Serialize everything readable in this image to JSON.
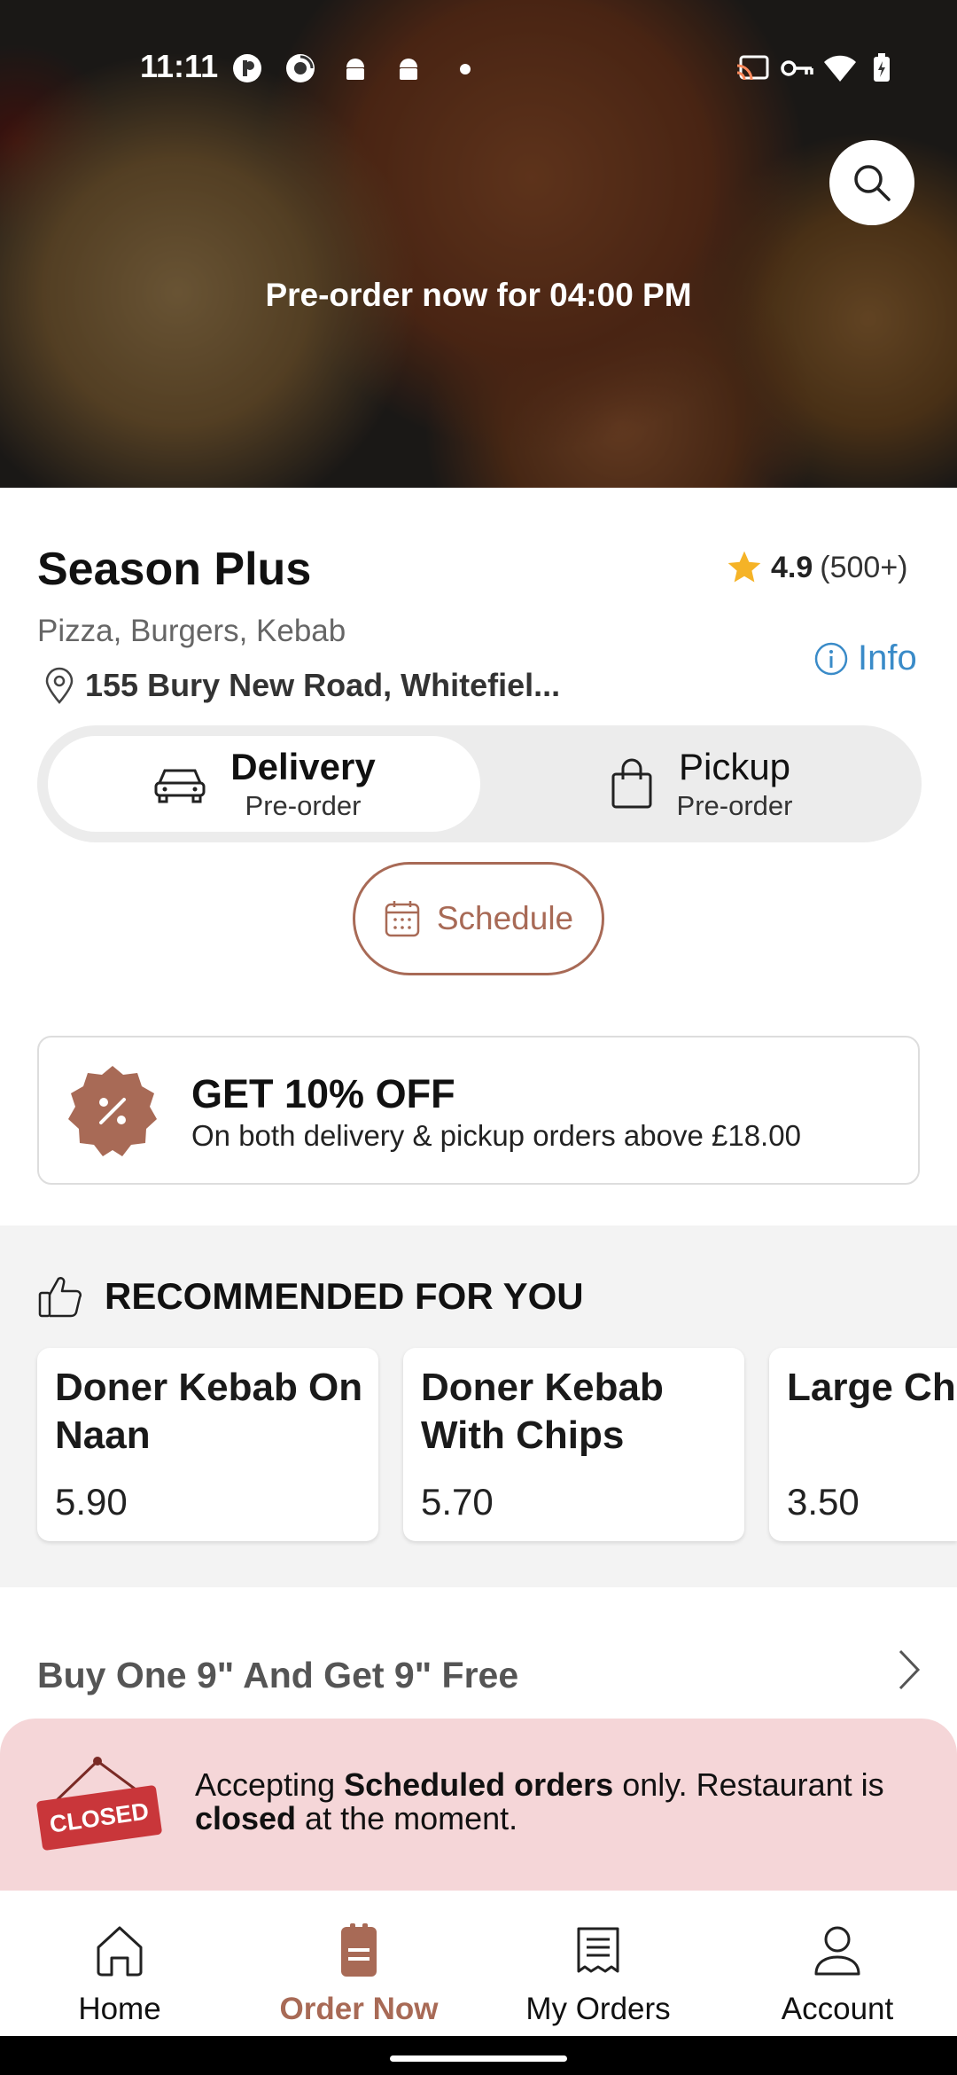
{
  "status_bar": {
    "time": "11:11",
    "icons": [
      "app-icon-1",
      "app-icon-2",
      "android-icon",
      "android-icon",
      "dot-indicator",
      "cast-icon",
      "vpn-key-icon",
      "wifi-icon",
      "battery-charging-icon"
    ]
  },
  "hero": {
    "banner_text": "Pre-order now for 04:00 PM",
    "search_icon": "search-icon"
  },
  "restaurant": {
    "name": "Season Plus",
    "rating": "4.9",
    "rating_count": "(500+)",
    "cuisines": "Pizza, Burgers, Kebab",
    "address": "155 Bury New Road, Whitefiel...",
    "info_label": "Info"
  },
  "order_type": {
    "options": [
      {
        "label": "Delivery",
        "sub": "Pre-order",
        "icon": "car-icon",
        "selected": true
      },
      {
        "label": "Pickup",
        "sub": "Pre-order",
        "icon": "bag-icon",
        "selected": false
      }
    ],
    "schedule_label": "Schedule"
  },
  "promo": {
    "title": "GET 10% OFF",
    "subtitle": "On both delivery & pickup orders above £18.00",
    "icon": "percent-badge-icon"
  },
  "recommended": {
    "heading": "RECOMMENDED FOR YOU",
    "items": [
      {
        "name": "Doner Kebab On Naan",
        "price": "5.90"
      },
      {
        "name": "Doner Kebab With Chips",
        "price": "5.70"
      },
      {
        "name": "Large Chi",
        "price": "3.50"
      }
    ]
  },
  "category_row": {
    "label": "Buy One 9\" And Get 9\" Free"
  },
  "closed_notice": {
    "sign_text": "CLOSED",
    "text_1": "Accepting ",
    "bold_1": "Scheduled orders",
    "text_2": " only. Restaurant is ",
    "bold_2": "closed",
    "text_3": " at the moment."
  },
  "bottom_nav": {
    "items": [
      {
        "label": "Home",
        "icon": "home-icon",
        "active": false
      },
      {
        "label": "Order Now",
        "icon": "order-menu-icon",
        "active": true
      },
      {
        "label": "My Orders",
        "icon": "receipt-icon",
        "active": false
      },
      {
        "label": "Account",
        "icon": "person-icon",
        "active": false
      }
    ]
  },
  "colors": {
    "accent": "#a86a56",
    "info_blue": "#3a8bc8",
    "star": "#f5b327",
    "closed_banner_bg": "#f5d6d8",
    "closed_sign": "#c9363a"
  }
}
